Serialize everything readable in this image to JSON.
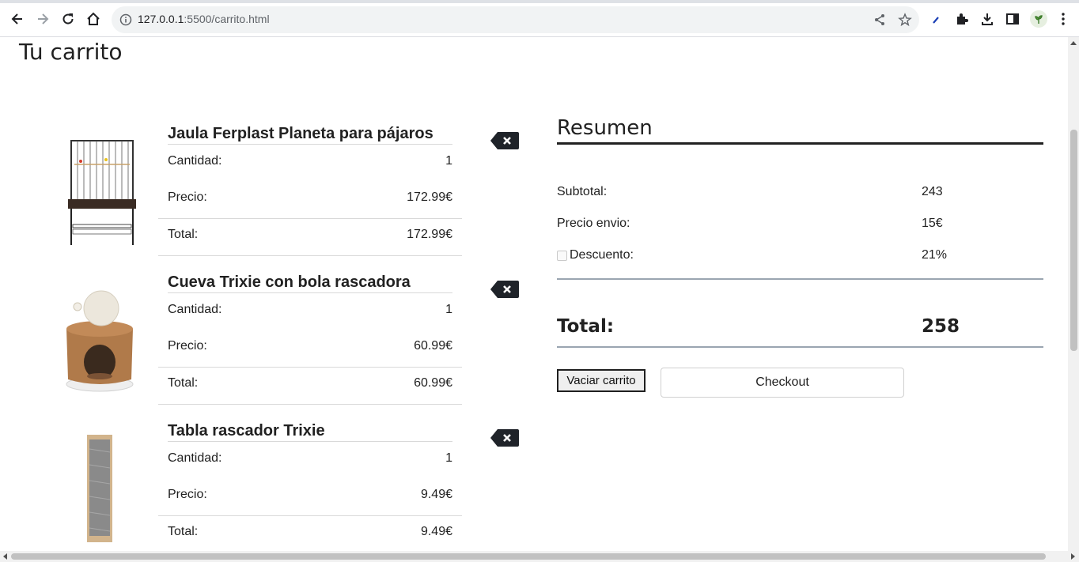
{
  "browser": {
    "url_host": "127.0.0.1",
    "url_rest": ":5500/carrito.html"
  },
  "page": {
    "title": "Tu carrito"
  },
  "cart": {
    "items": [
      {
        "name": "Jaula Ferplast Planeta para pájaros",
        "qty_label": "Cantidad:",
        "qty": "1",
        "price_label": "Precio:",
        "price": "172.99€",
        "total_label": "Total:",
        "total": "172.99€"
      },
      {
        "name": "Cueva Trixie con bola rascadora",
        "qty_label": "Cantidad:",
        "qty": "1",
        "price_label": "Precio:",
        "price": "60.99€",
        "total_label": "Total:",
        "total": "60.99€"
      },
      {
        "name": "Tabla rascador Trixie",
        "qty_label": "Cantidad:",
        "qty": "1",
        "price_label": "Precio:",
        "price": "9.49€",
        "total_label": "Total:",
        "total": "9.49€"
      }
    ]
  },
  "summary": {
    "title": "Resumen",
    "subtotal_label": "Subtotal:",
    "subtotal": "243",
    "shipping_label": "Precio envio:",
    "shipping": "15€",
    "discount_label": "Descuento:",
    "discount": "21%",
    "discount_checked": false,
    "total_label": "Total:",
    "total": "258",
    "empty_button": "Vaciar carrito",
    "checkout_button": "Checkout"
  },
  "icons": {
    "back": "arrow-left-icon",
    "forward": "arrow-right-icon",
    "reload": "reload-icon",
    "home": "home-icon",
    "info": "info-icon",
    "share": "share-icon",
    "bookmark": "star-icon",
    "extensions": "puzzle-icon",
    "downloads": "download-icon",
    "sidepanel": "side-panel-icon",
    "menu": "kebab-menu-icon",
    "delete": "backspace-delete-icon"
  },
  "colors": {
    "accent_dark": "#212121",
    "divider": "#d9d9d9",
    "summary_rule": "#9aa5b1"
  }
}
